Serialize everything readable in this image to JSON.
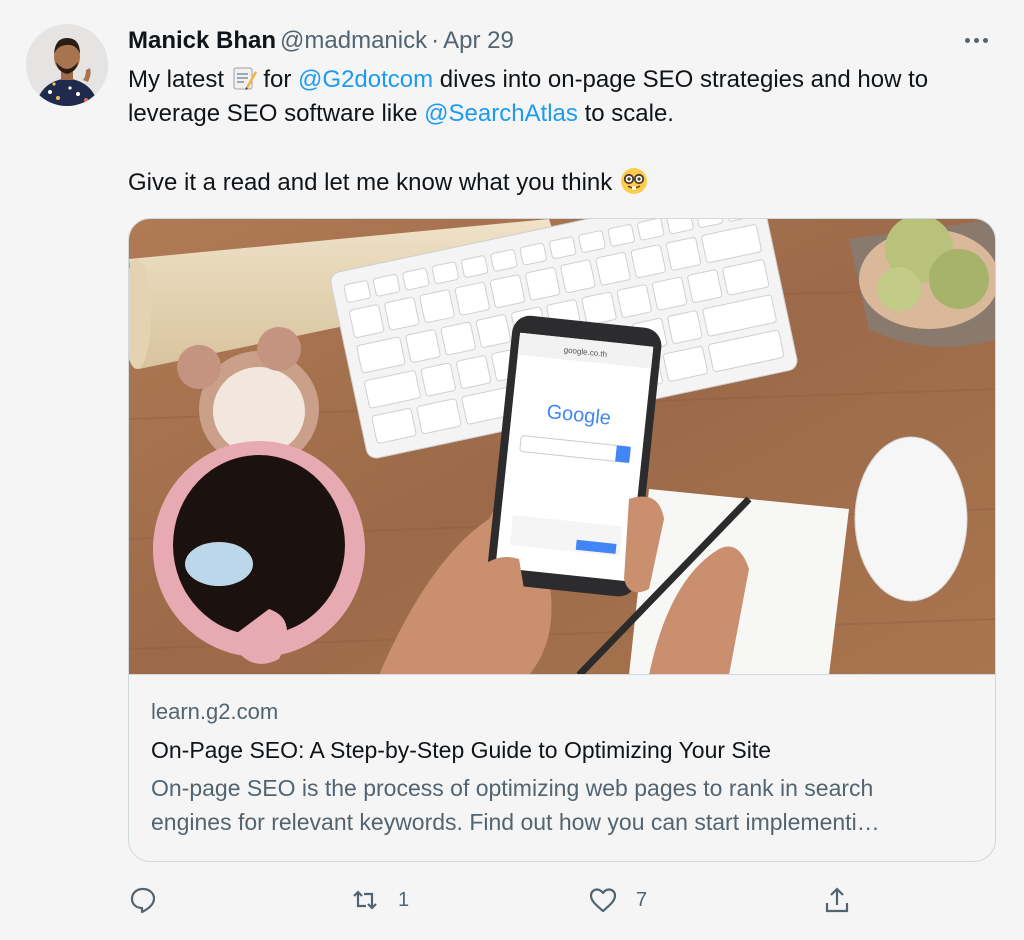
{
  "tweet": {
    "author_name": "Manick Bhan",
    "author_handle": "@madmanick",
    "separator": "·",
    "date": "Apr 29",
    "text": {
      "p1_a": "My latest ",
      "p1_b": " for ",
      "mention1": "@G2dotcom",
      "p1_c": " dives into on-page SEO strategies and how to",
      "p2_a": "leverage SEO software like ",
      "mention2": "@SearchAtlas",
      "p2_b": " to scale.",
      "p3": "Give it a read and let me know what you think "
    },
    "emojis": {
      "memo": "memo-emoji",
      "nerd": "nerd-face-emoji"
    }
  },
  "card": {
    "domain": "learn.g2.com",
    "title": "On-Page SEO: A Step-by-Step Guide to Optimizing Your Site",
    "description_line1": "On-page SEO is the process of optimizing web pages to rank in search",
    "description_line2": "engines for relevant keywords. Find out how you can start implementi…",
    "image": {
      "phone_brand": "Google",
      "phone_url": "google.co.th"
    }
  },
  "actions": {
    "reply_count": "",
    "retweet_count": "1",
    "like_count": "7",
    "share_count": ""
  },
  "colors": {
    "link": "#1d9bf0",
    "secondary": "#536471",
    "primary": "#0f1419",
    "border": "#cfd9de"
  }
}
